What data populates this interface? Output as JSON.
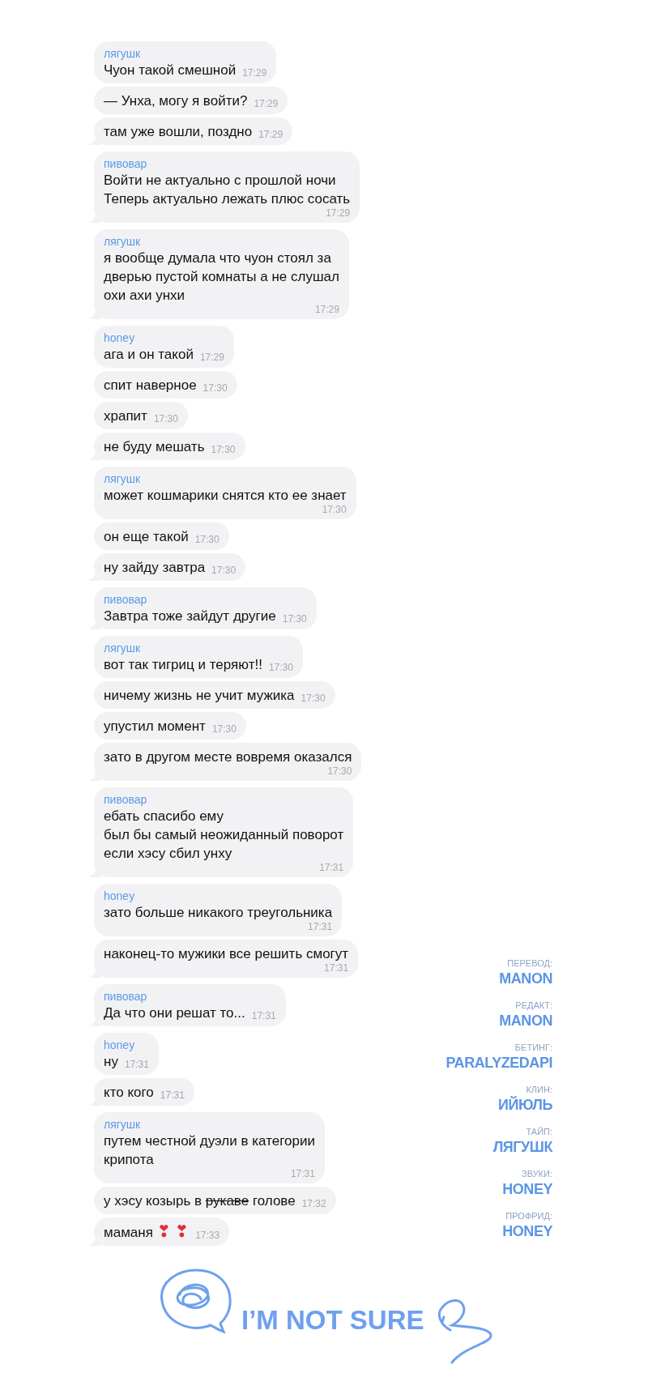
{
  "groups": [
    {
      "sender": "лягушк",
      "messages": [
        {
          "kind": "inline",
          "lines": [
            "Чуон такой смешной"
          ],
          "time": "17:29"
        },
        {
          "kind": "inline",
          "lines": [
            "— Унха, могу я войти?"
          ],
          "time": "17:29"
        },
        {
          "kind": "inline",
          "lines": [
            "там уже вошли, поздно"
          ],
          "time": "17:29"
        }
      ]
    },
    {
      "sender": "пивовар",
      "messages": [
        {
          "kind": "stacked",
          "lines": [
            "Войти не актуально с прошлой ночи",
            "Теперь актуально лежать плюс сосать"
          ],
          "time": "17:29"
        }
      ]
    },
    {
      "sender": "лягушк",
      "messages": [
        {
          "kind": "stacked",
          "lines": [
            "я вообще думала что чуон стоял за",
            "дверью пустой комнаты а не слушал",
            "охи ахи унхи"
          ],
          "time": "17:29"
        }
      ]
    },
    {
      "sender": "honey",
      "messages": [
        {
          "kind": "inline",
          "lines": [
            "ага и он такой"
          ],
          "time": "17:29"
        },
        {
          "kind": "inline",
          "lines": [
            "спит наверное"
          ],
          "time": "17:30"
        },
        {
          "kind": "inline",
          "lines": [
            "храпит"
          ],
          "time": "17:30"
        },
        {
          "kind": "inline",
          "lines": [
            "не буду мешать"
          ],
          "time": "17:30"
        }
      ]
    },
    {
      "sender": "лягушк",
      "messages": [
        {
          "kind": "stacked",
          "lines": [
            "может кошмарики снятся кто ее знает"
          ],
          "time": "17:30"
        },
        {
          "kind": "inline",
          "lines": [
            "он еще такой"
          ],
          "time": "17:30"
        },
        {
          "kind": "inline",
          "lines": [
            "ну зайду завтра"
          ],
          "time": "17:30"
        }
      ]
    },
    {
      "sender": "пивовар",
      "messages": [
        {
          "kind": "inline",
          "lines": [
            "Завтра тоже зайдут другие"
          ],
          "time": "17:30"
        }
      ]
    },
    {
      "sender": "лягушк",
      "messages": [
        {
          "kind": "inline",
          "lines": [
            "вот так тигриц и теряют!!"
          ],
          "time": "17:30"
        },
        {
          "kind": "inline",
          "lines": [
            "ничему жизнь не учит мужика"
          ],
          "time": "17:30"
        },
        {
          "kind": "inline",
          "lines": [
            "упустил момент"
          ],
          "time": "17:30"
        },
        {
          "kind": "stacked",
          "lines": [
            "зато в другом месте вовремя оказался"
          ],
          "time": "17:30"
        }
      ]
    },
    {
      "sender": "пивовар",
      "messages": [
        {
          "kind": "stacked",
          "lines": [
            "ебать спасибо ему",
            "был бы самый неожиданный поворот",
            "если хэсу сбил унху"
          ],
          "time": "17:31"
        }
      ]
    },
    {
      "sender": "honey",
      "messages": [
        {
          "kind": "stacked",
          "lines": [
            "зато больше никакого треугольника"
          ],
          "time": "17:31"
        },
        {
          "kind": "stacked",
          "lines": [
            "наконец-то мужики все решить смогут"
          ],
          "time": "17:31"
        }
      ]
    },
    {
      "sender": "пивовар",
      "messages": [
        {
          "kind": "inline",
          "lines": [
            "Да что они решат то..."
          ],
          "time": "17:31"
        }
      ]
    },
    {
      "sender": "honey",
      "messages": [
        {
          "kind": "inline",
          "lines": [
            "ну"
          ],
          "time": "17:31"
        },
        {
          "kind": "inline",
          "lines": [
            "кто кого"
          ],
          "time": "17:31"
        }
      ]
    },
    {
      "sender": "лягушк",
      "messages": [
        {
          "kind": "stacked",
          "lines": [
            "путем честной дуэли в категории",
            "крипота"
          ],
          "time": "17:31"
        },
        {
          "kind": "inline",
          "parts": [
            {
              "kind": "plain",
              "text": "у хэсу козырь в "
            },
            {
              "kind": "struck",
              "text": "рукаве"
            },
            {
              "kind": "plain",
              "text": " голове"
            }
          ],
          "time": "17:32"
        },
        {
          "kind": "inline",
          "parts": [
            {
              "kind": "plain",
              "text": "маманя "
            },
            {
              "kind": "emoji",
              "text": "❣ ❣"
            }
          ],
          "time": "17:33"
        }
      ]
    }
  ],
  "credits": [
    {
      "role": "ПЕРЕВОД:",
      "name": "MANON"
    },
    {
      "role": "РЕДАКТ:",
      "name": "MANON"
    },
    {
      "role": "БЕТИНГ:",
      "name": "PARALYZEDAPI"
    },
    {
      "role": "КЛИН:",
      "name": "ИЙЮЛЬ"
    },
    {
      "role": "ТАЙП:",
      "name": "ЛЯГУШК"
    },
    {
      "role": "ЗВУКИ:",
      "name": "HONEY"
    },
    {
      "role": "ПРОФРИД:",
      "name": "HONEY"
    }
  ],
  "logo": {
    "text": "I’M NOT SURE"
  }
}
